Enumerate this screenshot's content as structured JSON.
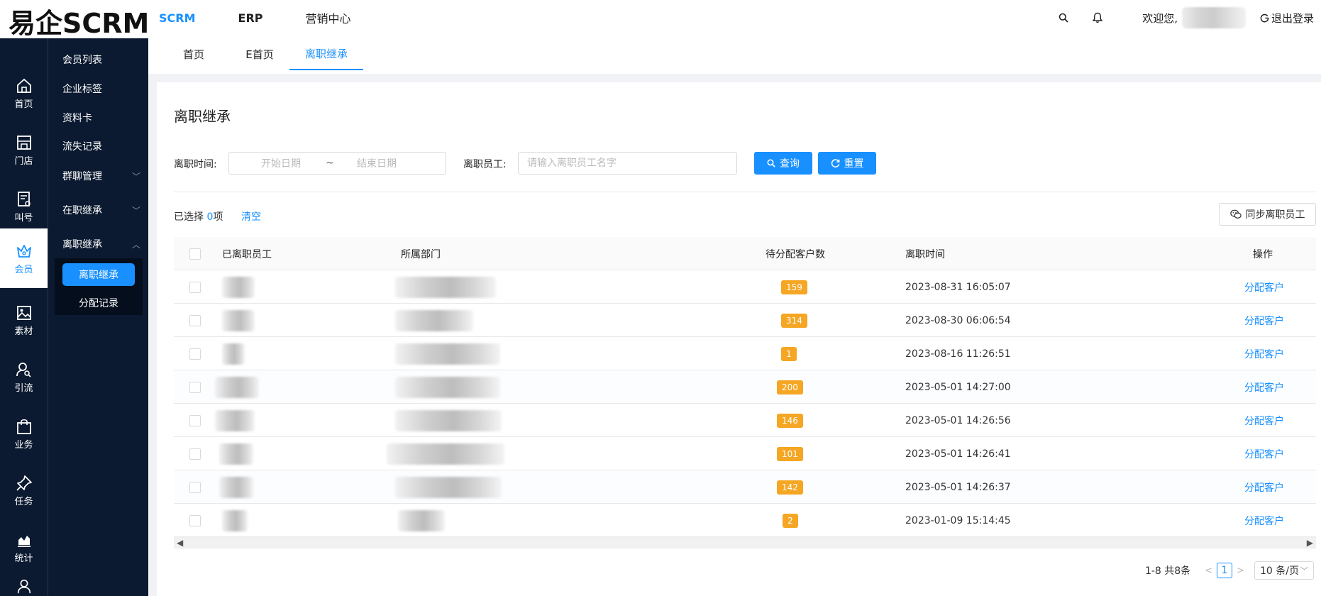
{
  "logo": "易企SCRM",
  "topnav": [
    {
      "label": "SCRM",
      "active": true
    },
    {
      "label": "ERP",
      "active": false
    },
    {
      "label": "营销中心",
      "active": false
    }
  ],
  "top_right": {
    "welcome": "欢迎您,",
    "logout": "退出登录"
  },
  "iconbar": [
    {
      "label": "首页",
      "icon": "home-icon"
    },
    {
      "label": "门店",
      "icon": "store-icon"
    },
    {
      "label": "叫号",
      "icon": "queue-icon"
    },
    {
      "label": "会员",
      "icon": "crown-icon",
      "active": true
    },
    {
      "label": "素材",
      "icon": "image-icon"
    },
    {
      "label": "引流",
      "icon": "user-search-icon"
    },
    {
      "label": "业务",
      "icon": "bag-icon"
    },
    {
      "label": "任务",
      "icon": "pin-icon"
    },
    {
      "label": "统计",
      "icon": "chart-icon"
    },
    {
      "label": "",
      "icon": "user-icon"
    }
  ],
  "subbar": {
    "items": [
      {
        "label": "会员列表",
        "chevron": ""
      },
      {
        "label": "企业标签",
        "chevron": ""
      },
      {
        "label": "资料卡",
        "chevron": ""
      },
      {
        "label": "流失记录",
        "chevron": ""
      },
      {
        "label": "群聊管理",
        "chevron": "﹀"
      },
      {
        "label": "在职继承",
        "chevron": "﹀"
      },
      {
        "label": "离职继承",
        "chevron": "︿"
      }
    ],
    "sub_items": [
      {
        "label": "离职继承",
        "active": true
      },
      {
        "label": "分配记录",
        "active": false
      }
    ]
  },
  "tabs": [
    {
      "label": "首页",
      "active": false
    },
    {
      "label": "E首页",
      "active": false
    },
    {
      "label": "离职继承",
      "active": true
    }
  ],
  "page_title": "离职继承",
  "filters": {
    "leave_time_label": "离职时间:",
    "start_placeholder": "开始日期",
    "range_sep": "~",
    "end_placeholder": "结束日期",
    "employee_label": "离职员工:",
    "employee_placeholder": "请输入离职员工名字",
    "search_label": "查询",
    "reset_label": "重置"
  },
  "selection": {
    "prefix": "已选择 ",
    "count": "0",
    "suffix": "项",
    "clear": "清空"
  },
  "sync_label": "同步离职员工",
  "table": {
    "headers": [
      "已离职员工",
      "所属部门",
      "待分配客户数",
      "离职时间",
      "操作"
    ],
    "rows": [
      {
        "count": "159",
        "time": "2023-08-31 16:05:07",
        "action": "分配客户"
      },
      {
        "count": "314",
        "time": "2023-08-30 06:06:54",
        "action": "分配客户"
      },
      {
        "count": "1",
        "time": "2023-08-16 11:26:51",
        "action": "分配客户"
      },
      {
        "count": "200",
        "time": "2023-05-01 14:27:00",
        "action": "分配客户"
      },
      {
        "count": "146",
        "time": "2023-05-01 14:26:56",
        "action": "分配客户"
      },
      {
        "count": "101",
        "time": "2023-05-01 14:26:41",
        "action": "分配客户"
      },
      {
        "count": "142",
        "time": "2023-05-01 14:26:37",
        "action": "分配客户"
      },
      {
        "count": "2",
        "time": "2023-01-09 15:14:45",
        "action": "分配客户"
      }
    ]
  },
  "pagination": {
    "total": "1-8 共8条",
    "prev": "<",
    "current": "1",
    "next": ">",
    "page_size": "10 条/页"
  }
}
